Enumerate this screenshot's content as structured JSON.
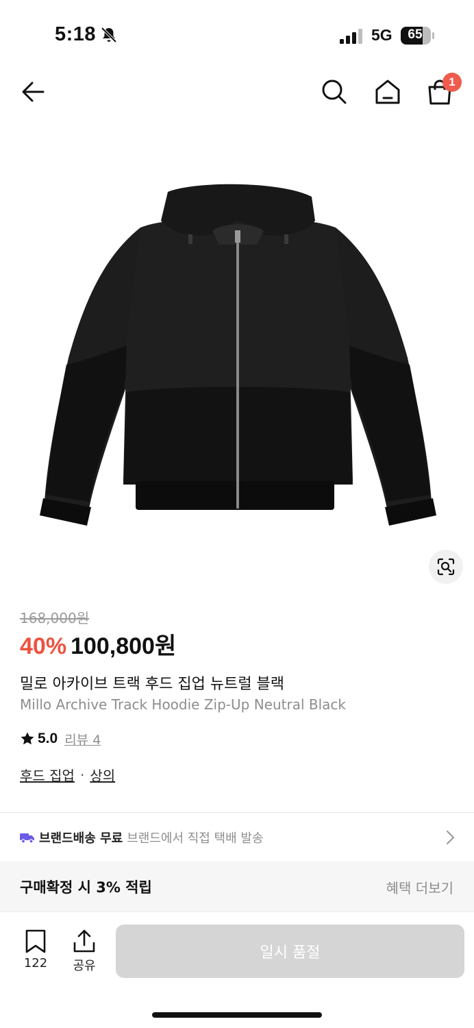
{
  "status_bar": {
    "time": "5:18",
    "network": "5G",
    "battery": "65"
  },
  "nav": {
    "cart_count": "1"
  },
  "product": {
    "original_price": "168,000원",
    "discount": "40%",
    "sale_price": "100,800원",
    "title_ko": "밀로 아카이브 트랙 후드 집업 뉴트럴 블랙",
    "title_en": "Millo Archive Track Hoodie Zip-Up Neutral Black",
    "rating": "5.0",
    "review_link": "리뷰 4",
    "categories": [
      "후드 집업",
      "상의"
    ],
    "category_separator": "·"
  },
  "shipping": {
    "title": "브랜드배송 무료",
    "description": "브랜드에서 직접 택배 발송"
  },
  "benefit": {
    "text": "구매확정 시 3% 적립",
    "more_label": "혜택 더보기"
  },
  "bottom_bar": {
    "bookmark_count": "122",
    "share_label": "공유",
    "buy_button_label": "일시 품절"
  },
  "colors": {
    "discount": "#ec5340",
    "badge": "#ef5b4c",
    "button_disabled": "#d5d5d5",
    "truck": "#6b5ce7"
  },
  "icons": [
    "bell-slash-icon",
    "signal-icon",
    "battery-icon",
    "back-arrow-icon",
    "search-icon",
    "home-icon",
    "shopping-bag-icon",
    "lens-search-icon",
    "star-icon",
    "truck-icon",
    "chevron-right-icon",
    "bookmark-icon",
    "share-icon"
  ]
}
